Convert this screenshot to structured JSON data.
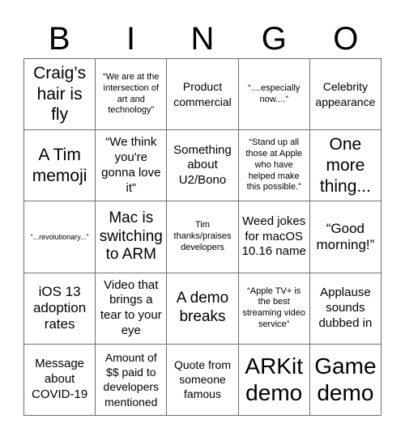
{
  "header": {
    "letters": [
      "B",
      "I",
      "N",
      "G",
      "O"
    ]
  },
  "cells": [
    [
      "Craig’s hair is fly",
      "“We are at the intersection of art and technology”",
      "Product commercial",
      "“....especially now....”",
      "Celebrity appearance"
    ],
    [
      "A Tim memoji",
      "“We think you're gonna love it”",
      "Something about U2/Bono",
      "“Stand up all those at Apple who have helped make this possible.”",
      "One more thing..."
    ],
    [
      "“...revolutionary...”",
      "Mac is switching to ARM",
      "Tim thanks/praises developers",
      "Weed jokes for macOS 10.16 name",
      "“Good morning!”"
    ],
    [
      "iOS 13 adoption rates",
      "Video that brings a tear to your eye",
      "A demo breaks",
      "“Apple TV+ is the best streaming video service”",
      "Applause sounds dubbed in"
    ],
    [
      "Message about COVID-19",
      "Amount of $$ paid to developers mentioned",
      "Quote from someone famous",
      "ARKit demo",
      "Game demo"
    ]
  ]
}
